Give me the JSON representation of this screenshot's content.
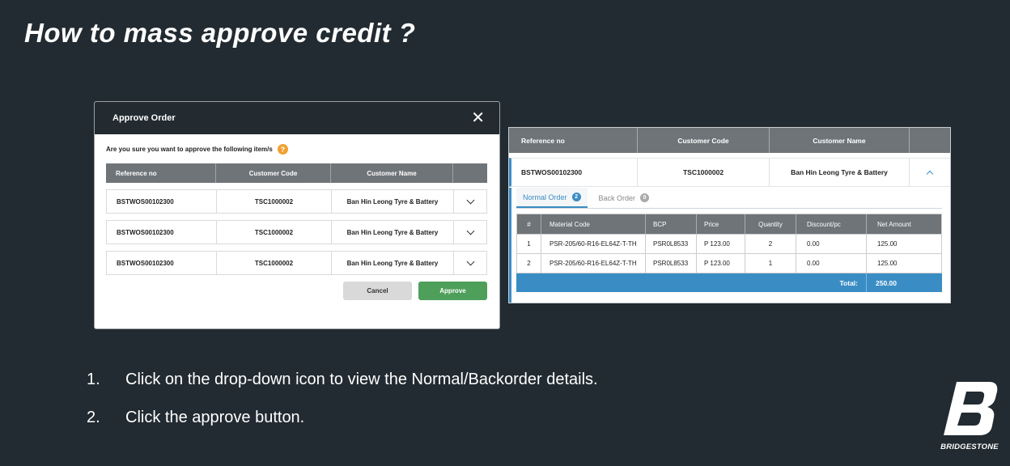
{
  "slide": {
    "title": "How to mass approve credit ?"
  },
  "modal": {
    "title": "Approve Order",
    "close_glyph": "✕",
    "confirm_text": "Are you sure you want to approve the following item/s",
    "help_glyph": "?",
    "columns": [
      "Reference no",
      "Customer Code",
      "Customer Name"
    ],
    "rows": [
      {
        "ref": "BSTWOS00102300",
        "code": "TSC1000002",
        "name": "Ban Hin Leong Tyre & Battery"
      },
      {
        "ref": "BSTWOS00102300",
        "code": "TSC1000002",
        "name": "Ban Hin Leong Tyre & Battery"
      },
      {
        "ref": "BSTWOS00102300",
        "code": "TSC1000002",
        "name": "Ban Hin Leong Tyre & Battery"
      }
    ],
    "cancel_label": "Cancel",
    "approve_label": "Approve",
    "colors": {
      "header": "#232b31",
      "approve": "#4e9f5a",
      "cancel": "#d9d9d9"
    }
  },
  "detail": {
    "columns": [
      "Reference no",
      "Customer Code",
      "Customer Name"
    ],
    "row": {
      "ref": "BSTWOS00102300",
      "code": "TSC1000002",
      "name": "Ban Hin Leong Tyre & Battery"
    },
    "tabs": [
      {
        "label": "Normal Order",
        "count": "2",
        "active": true
      },
      {
        "label": "Back Order",
        "count": "0",
        "active": false
      }
    ],
    "item_columns": [
      "#",
      "Material Code",
      "BCP",
      "Price",
      "Quantity",
      "Discount/pc",
      "Net Amount"
    ],
    "items": [
      {
        "no": "1",
        "material": "PSR-205/60-R16-EL64Z-T-TH",
        "bcp": "PSR0L8533",
        "price": "P 123.00",
        "qty": "2",
        "discount": "0.00",
        "net": "125.00"
      },
      {
        "no": "2",
        "material": "PSR-205/60-R16-EL64Z-T-TH",
        "bcp": "PSR0L8533",
        "price": "P 123.00",
        "qty": "1",
        "discount": "0.00",
        "net": "125.00"
      }
    ],
    "total_label": "Total:",
    "total_value": "250.00",
    "colors": {
      "accent": "#3a8dc4",
      "header": "#6f7478"
    }
  },
  "instructions": [
    {
      "num": "1.",
      "text": "Click on the drop-down icon to view the Normal/Backorder details."
    },
    {
      "num": "2.",
      "text": "Click the approve button."
    }
  ],
  "logo": {
    "text": "BRIDGESTONE",
    "icon": "bridgestone-b-icon"
  }
}
